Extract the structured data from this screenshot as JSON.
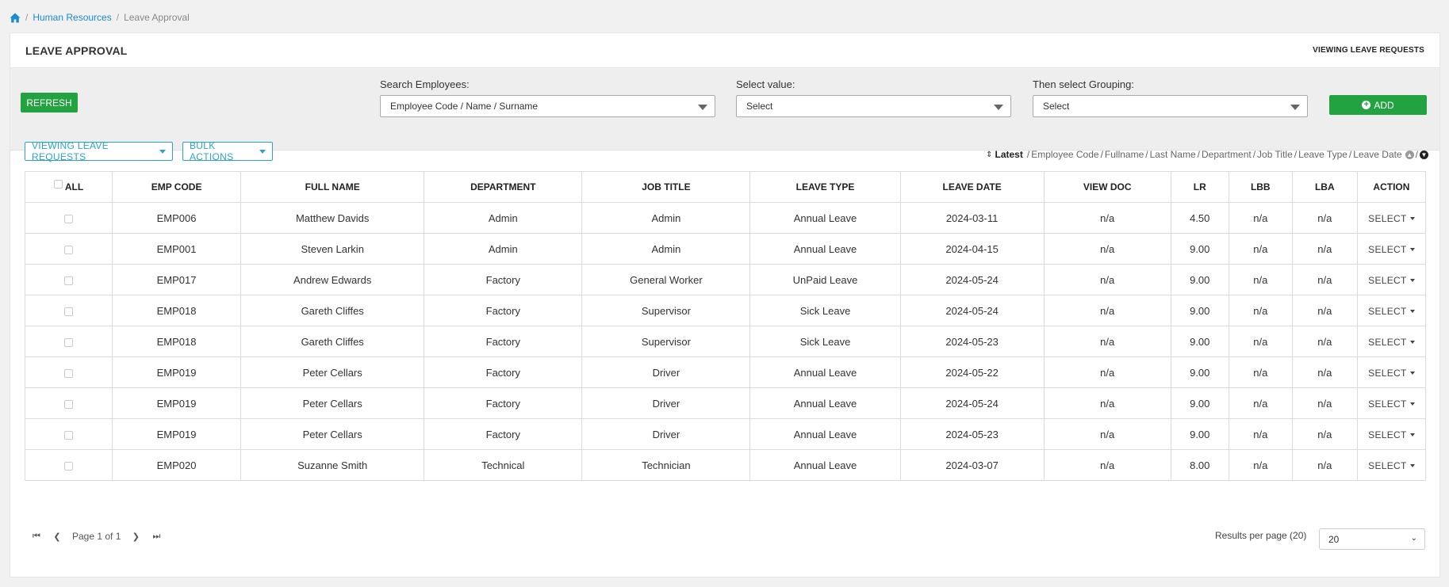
{
  "breadcrumb": {
    "home_icon": "home-icon",
    "section": "Human Resources",
    "page": "Leave Approval"
  },
  "header": {
    "title": "LEAVE APPROVAL",
    "viewing": "VIEWING LEAVE REQUESTS"
  },
  "filters": {
    "refresh_label": "REFRESH",
    "search_label": "Search Employees:",
    "search_value": "Employee Code / Name / Surname",
    "value_label": "Select value:",
    "value_value": "Select",
    "grouping_label": "Then select Grouping:",
    "grouping_value": "Select",
    "add_label": "ADD"
  },
  "toolbar": {
    "view_dropdown": "VIEWING LEAVE REQUESTS",
    "bulk_dropdown": "BULK ACTIONS"
  },
  "sort": {
    "active": "Latest",
    "options": [
      "Employee Code",
      "Fullname",
      "Last Name",
      "Department",
      "Job Title",
      "Leave Type",
      "Leave Date"
    ],
    "asc_icon": "arrow-up-circle-icon",
    "desc_icon": "arrow-down-circle-icon"
  },
  "table": {
    "columns": [
      "ALL",
      "EMP CODE",
      "FULL NAME",
      "DEPARTMENT",
      "JOB TITLE",
      "LEAVE TYPE",
      "LEAVE DATE",
      "VIEW DOC",
      "LR",
      "LBB",
      "LBA",
      "ACTION"
    ],
    "action_label": "SELECT",
    "rows": [
      [
        "EMP006",
        "Matthew Davids",
        "Admin",
        "Admin",
        "Annual Leave",
        "2024-03-11",
        "n/a",
        "4.50",
        "n/a",
        "n/a"
      ],
      [
        "EMP001",
        "Steven Larkin",
        "Admin",
        "Admin",
        "Annual Leave",
        "2024-04-15",
        "n/a",
        "9.00",
        "n/a",
        "n/a"
      ],
      [
        "EMP017",
        "Andrew Edwards",
        "Factory",
        "General Worker",
        "UnPaid Leave",
        "2024-05-24",
        "n/a",
        "9.00",
        "n/a",
        "n/a"
      ],
      [
        "EMP018",
        "Gareth Cliffes",
        "Factory",
        "Supervisor",
        "Sick Leave",
        "2024-05-24",
        "n/a",
        "9.00",
        "n/a",
        "n/a"
      ],
      [
        "EMP018",
        "Gareth Cliffes",
        "Factory",
        "Supervisor",
        "Sick Leave",
        "2024-05-23",
        "n/a",
        "9.00",
        "n/a",
        "n/a"
      ],
      [
        "EMP019",
        "Peter Cellars",
        "Factory",
        "Driver",
        "Annual Leave",
        "2024-05-22",
        "n/a",
        "9.00",
        "n/a",
        "n/a"
      ],
      [
        "EMP019",
        "Peter Cellars",
        "Factory",
        "Driver",
        "Annual Leave",
        "2024-05-24",
        "n/a",
        "9.00",
        "n/a",
        "n/a"
      ],
      [
        "EMP019",
        "Peter Cellars",
        "Factory",
        "Driver",
        "Annual Leave",
        "2024-05-23",
        "n/a",
        "9.00",
        "n/a",
        "n/a"
      ],
      [
        "EMP020",
        "Suzanne Smith",
        "Technical",
        "Technician",
        "Annual Leave",
        "2024-03-07",
        "n/a",
        "8.00",
        "n/a",
        "n/a"
      ]
    ]
  },
  "pagination": {
    "page_text": "Page 1 of 1",
    "rpp_label": "Results per page (20)",
    "rpp_value": "20"
  },
  "colors": {
    "accent_green": "#23a241",
    "accent_blue": "#2aa5c9",
    "link_blue": "#1e8bd1"
  }
}
